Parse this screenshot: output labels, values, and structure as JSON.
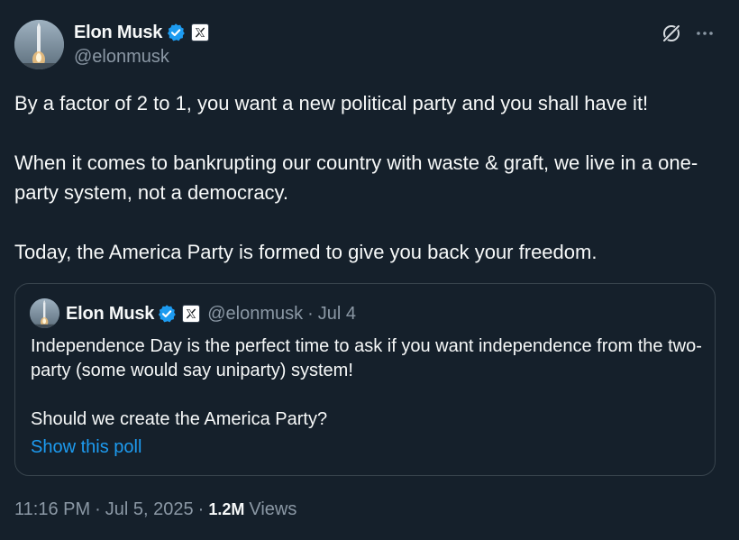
{
  "author": {
    "display_name": "Elon Musk",
    "handle": "@elonmusk",
    "verified_icon": "verified-badge-icon",
    "affiliation_icon": "x-logo-icon"
  },
  "actions": {
    "grok_icon": "grok-icon",
    "more_icon": "more-icon"
  },
  "tweet": {
    "paragraphs": [
      "By a factor of 2 to 1, you want a new political party and you shall have it!",
      "When it comes to bankrupting our country with waste & graft, we live in a one-party system, not a democracy.",
      "Today, the America Party is formed to give you back your freedom."
    ]
  },
  "quote": {
    "display_name": "Elon Musk",
    "handle": "@elonmusk",
    "separator": "·",
    "date": "Jul 4",
    "paragraphs": [
      "Independence Day is the perfect time to ask if you want independence from the two-party (some would say uniparty) system!",
      "Should we create the America Party?"
    ],
    "poll_link": "Show this poll"
  },
  "meta": {
    "time": "11:16 PM",
    "separator": "·",
    "date": "Jul 5, 2025",
    "views_count": "1.2M",
    "views_label": "Views"
  },
  "colors": {
    "background": "#15202b",
    "text": "#f7f9f9",
    "secondary_text": "#8b98a5",
    "accent": "#1d9bf0",
    "border": "#38444d"
  }
}
